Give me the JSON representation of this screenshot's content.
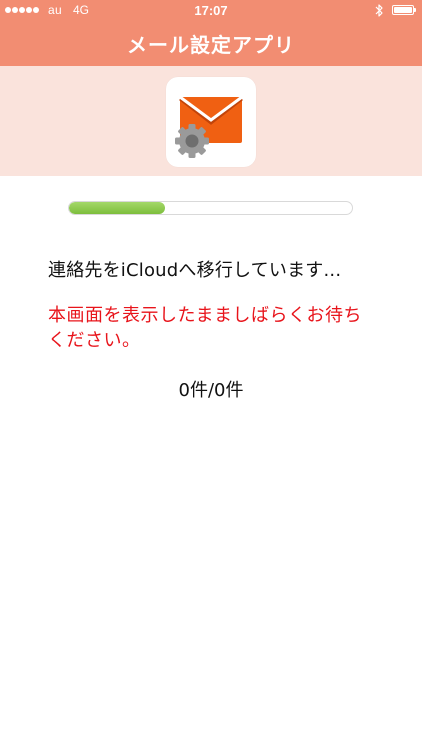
{
  "status_bar": {
    "carrier": "au",
    "network": "4G",
    "time": "17:07"
  },
  "app": {
    "title": "メール設定アプリ",
    "icon": "mail-settings-icon",
    "accent_color": "#f28d72",
    "banner_color": "#fae3dc"
  },
  "progress": {
    "fraction": 0.34,
    "color": "#8cc84b"
  },
  "main": {
    "message": "連絡先をiCloudへ移行しています...",
    "warning": "本画面を表示したまましばらくお待ちください。",
    "counter": "0件/0件"
  }
}
